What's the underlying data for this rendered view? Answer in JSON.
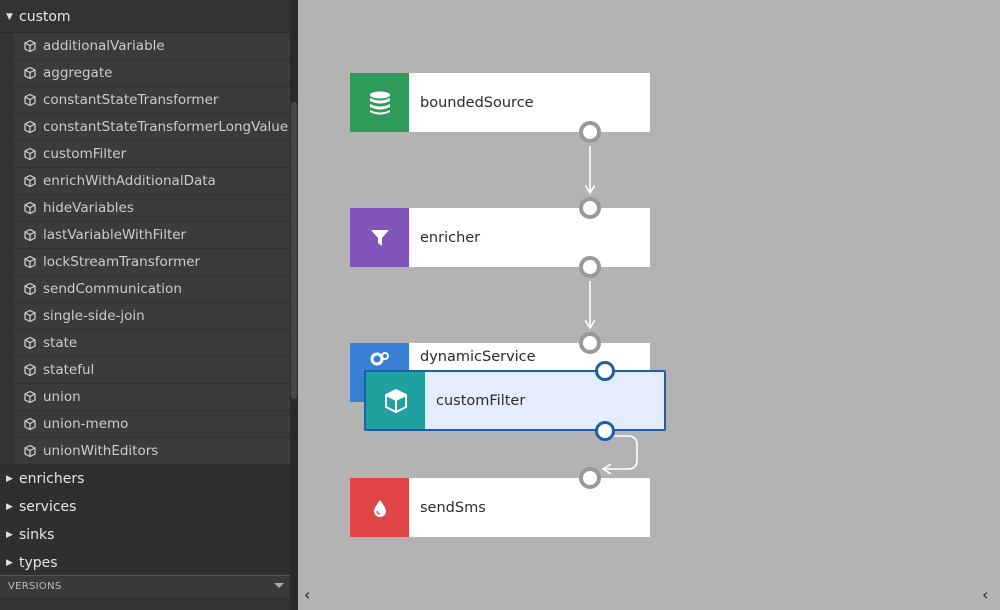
{
  "sidebar": {
    "custom_group": {
      "label": "custom",
      "arrow": "▼"
    },
    "items": [
      "additionalVariable",
      "aggregate",
      "constantStateTransformer",
      "constantStateTransformerLongValue",
      "customFilter",
      "enrichWithAdditionalData",
      "hideVariables",
      "lastVariableWithFilter",
      "lockStreamTransformer",
      "sendCommunication",
      "single-side-join",
      "state",
      "stateful",
      "union",
      "union-memo",
      "unionWithEditors"
    ],
    "closed_groups": [
      {
        "label": "enrichers",
        "arrow": "▶"
      },
      {
        "label": "services",
        "arrow": "▶"
      },
      {
        "label": "sinks",
        "arrow": "▶"
      },
      {
        "label": "types",
        "arrow": "▶"
      }
    ],
    "versions_label": "VERSIONS"
  },
  "canvas": {
    "nodes": {
      "boundedSource": {
        "label": "boundedSource",
        "color": "#2e9b58",
        "icon": "database-icon"
      },
      "enricher": {
        "label": "enricher",
        "color": "#8054b8",
        "icon": "filter-icon"
      },
      "dynamicService": {
        "label": "dynamicService",
        "color": "#3a7fd6",
        "icon": "gears-icon"
      },
      "customFilter": {
        "label": "customFilter",
        "color": "#21a0a0",
        "icon": "cube-icon"
      },
      "sendSms": {
        "label": "sendSms",
        "color": "#e04646",
        "icon": "drop-icon"
      }
    },
    "nav_left": "‹",
    "nav_right": "‹"
  },
  "colors": {
    "selection_border": "#1f5ea6",
    "selection_fill": "#e5ecfb",
    "port_gray": "#999999"
  }
}
